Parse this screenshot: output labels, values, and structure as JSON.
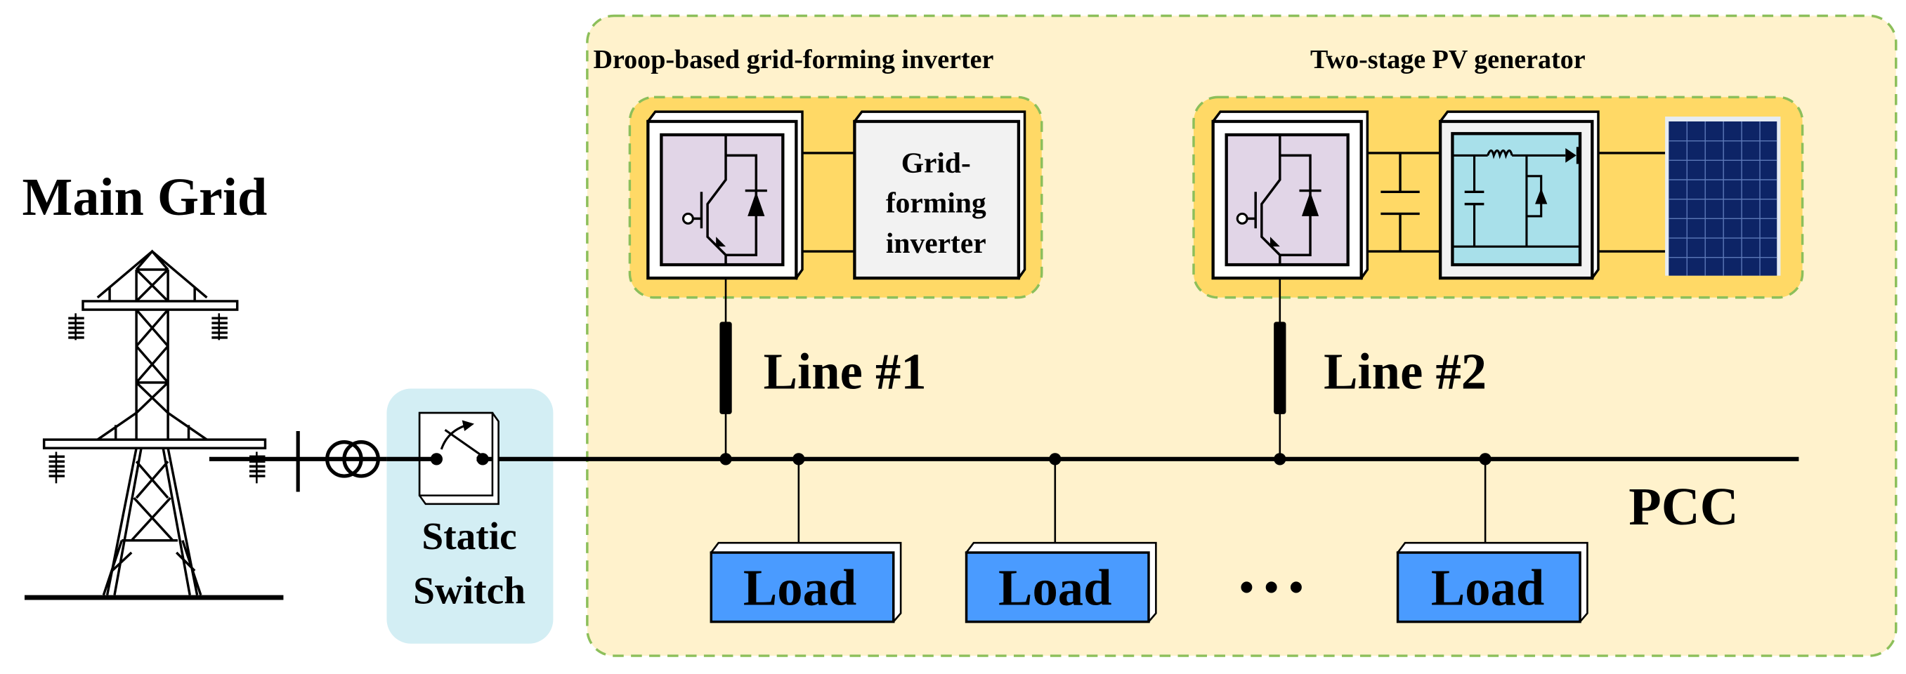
{
  "main_grid": {
    "label": "Main Grid"
  },
  "static_switch": {
    "label_line1": "Static",
    "label_line2": "Switch"
  },
  "gfm_group": {
    "title": "Droop-based grid-forming inverter",
    "controller": {
      "line1": "Grid-",
      "line2": "forming",
      "line3": "inverter"
    }
  },
  "pv_group": {
    "title": "Two-stage PV generator"
  },
  "lines": [
    {
      "label": "Line #1"
    },
    {
      "label": "Line #2"
    }
  ],
  "bus": {
    "label": "PCC"
  },
  "loads": [
    {
      "label": "Load"
    },
    {
      "label": "Load"
    },
    {
      "label": "Load"
    }
  ],
  "ellipsis": "• • •",
  "colors": {
    "microgrid_bg": "#fff2cc",
    "dashed_border": "#8cbf5a",
    "group_bg": "#ffd966",
    "igbt_fill": "#e1d5e7",
    "dcdc_fill": "#a8e0ea",
    "load_fill": "#4a9bff",
    "switch_bg": "#d3eef4",
    "panel_fill": "#0d2466"
  }
}
